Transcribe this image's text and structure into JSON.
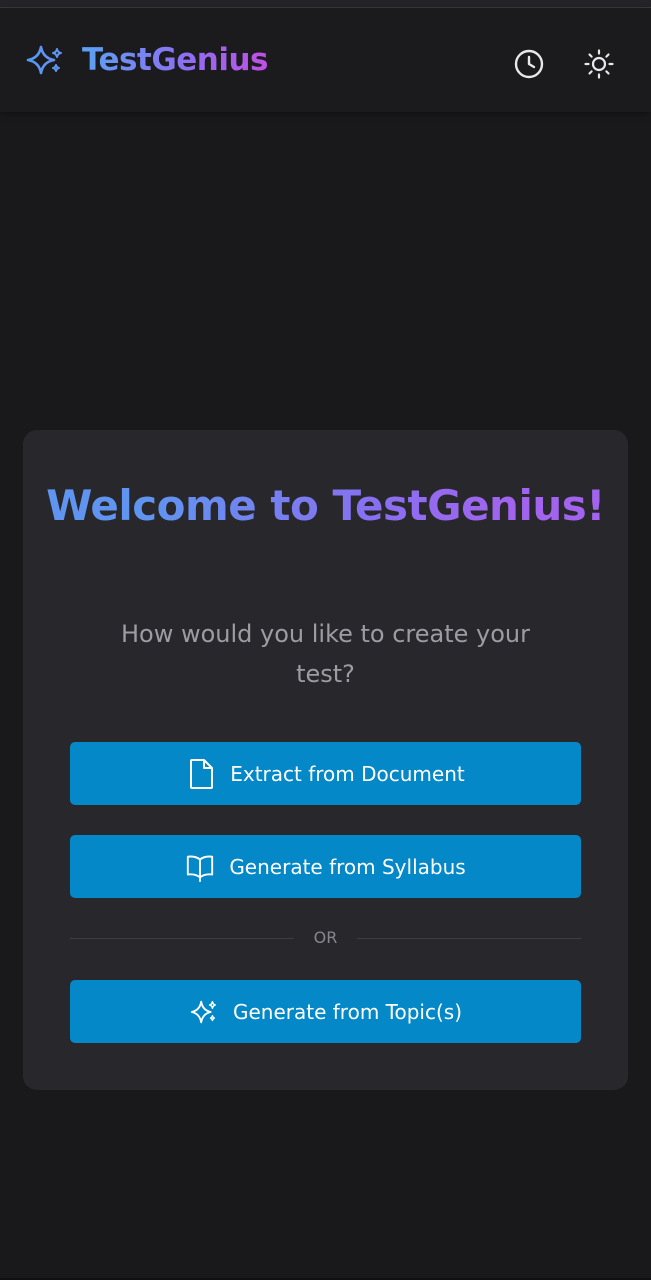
{
  "app": {
    "name": "TestGenius",
    "brand_icon": "sparkles-icon",
    "accent_gradient": [
      "#5aa2f3",
      "#8d6ff2",
      "#c14fe6"
    ]
  },
  "header": {
    "history_icon": "clock-icon",
    "theme_icon": "sun-icon"
  },
  "welcome": {
    "title": "Welcome to TestGenius!",
    "subtitle": "How would you like to create your test?"
  },
  "actions": [
    {
      "label": "Extract from Document",
      "icon": "file-icon"
    },
    {
      "label": "Generate from Syllabus",
      "icon": "book-open-icon"
    },
    {
      "label": "Generate from Topic(s)",
      "icon": "sparkles-icon"
    }
  ],
  "divider_text": "OR",
  "colors": {
    "background": "#19191c",
    "card": "#28282c",
    "button": "#0588c8",
    "subtitle": "#9c9ca3"
  }
}
